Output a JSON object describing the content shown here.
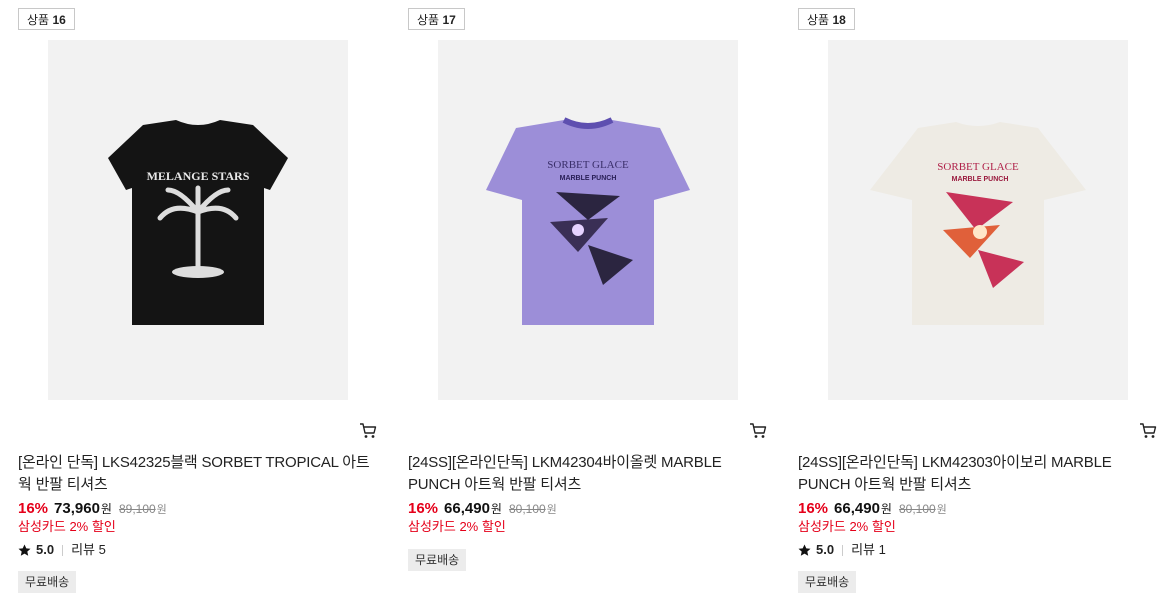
{
  "products": [
    {
      "badge_prefix": "상품",
      "badge_num": "16",
      "title": "[온라인 단독] LKS42325블랙 SORBET TROPICAL 아트웍 반팔 티셔츠",
      "discount_rate": "16%",
      "price": "73,960",
      "currency": "원",
      "original_price": "89,100",
      "card_discount": "삼성카드 2% 할인",
      "rating": "5.0",
      "review": "리뷰 5",
      "shipping": "무료배송",
      "shirt_color": "#141414",
      "print_text": "MELANGE STARS"
    },
    {
      "badge_prefix": "상품",
      "badge_num": "17",
      "title": "[24SS][온라인단독] LKM42304바이올렛 MARBLE PUNCH 아트웍 반팔 티셔츠",
      "discount_rate": "16%",
      "price": "66,490",
      "currency": "원",
      "original_price": "80,100",
      "card_discount": "삼성카드 2% 할인",
      "shipping": "무료배송",
      "shirt_color": "#9c8ed8",
      "print_text": "SORBET GLACE",
      "print_sub": "MARBLE PUNCH"
    },
    {
      "badge_prefix": "상품",
      "badge_num": "18",
      "title": "[24SS][온라인단독] LKM42303아이보리 MARBLE PUNCH 아트웍 반팔 티셔츠",
      "discount_rate": "16%",
      "price": "66,490",
      "currency": "원",
      "original_price": "80,100",
      "card_discount": "삼성카드 2% 할인",
      "rating": "5.0",
      "review": "리뷰 1",
      "shipping": "무료배송",
      "shirt_color": "#eeebe4",
      "print_text": "SORBET GLACE",
      "print_sub": "MARBLE PUNCH"
    }
  ],
  "icons": {
    "cart": "cart-icon",
    "star": "star-icon"
  },
  "colors": {
    "discount": "#e5001a",
    "badge_border": "#c8c8c8",
    "ship_bg": "#ececec"
  }
}
